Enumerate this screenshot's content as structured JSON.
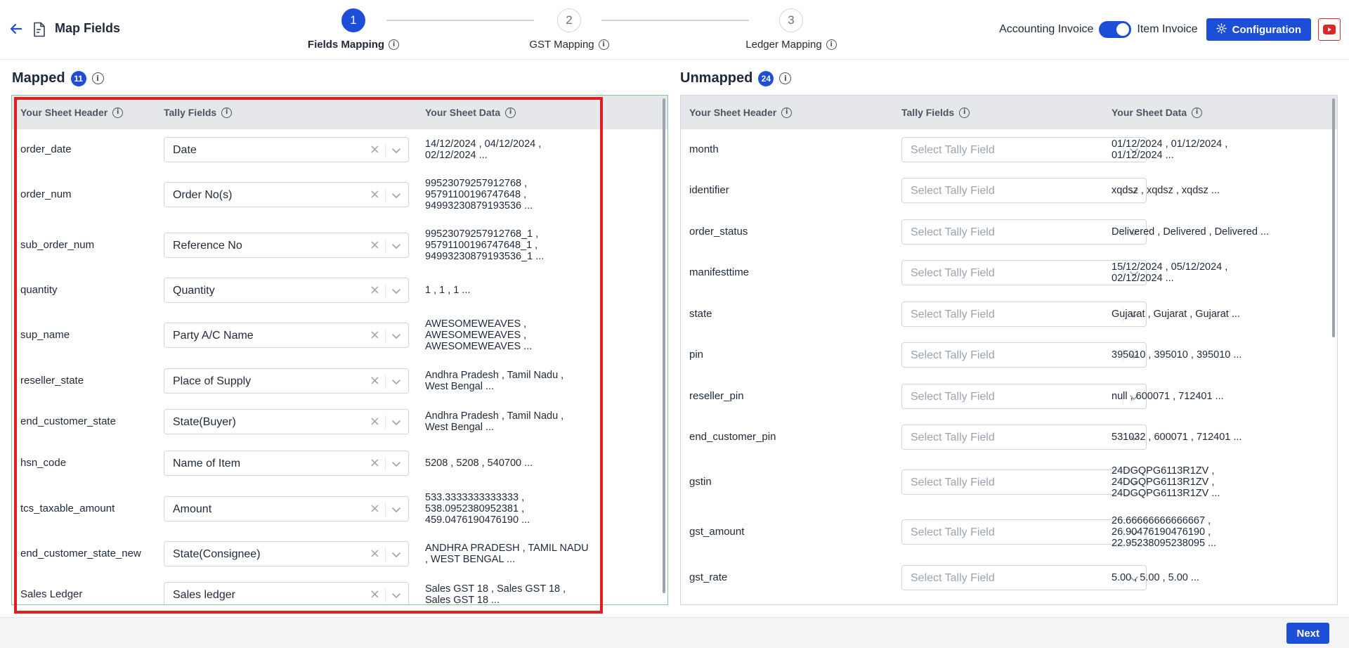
{
  "header": {
    "title": "Map Fields",
    "steps": [
      {
        "number": "1",
        "label": "Fields Mapping",
        "active": true
      },
      {
        "number": "2",
        "label": "GST Mapping",
        "active": false
      },
      {
        "number": "3",
        "label": "Ledger Mapping",
        "active": false
      }
    ],
    "toggle_left_label": "Accounting Invoice",
    "toggle_right_label": "Item Invoice",
    "config_label": "Configuration"
  },
  "mapped": {
    "title": "Mapped",
    "count": "11",
    "columns": [
      "Your Sheet Header",
      "Tally Fields",
      "Your Sheet Data"
    ],
    "rows": [
      {
        "header": "order_date",
        "field": "Date",
        "data": [
          "14/12/2024 , 04/12/2024 ,",
          "02/12/2024 ..."
        ]
      },
      {
        "header": "order_num",
        "field": "Order No(s)",
        "data": [
          "99523079257912768 ,",
          "95791100196747648 ,",
          "94993230879193536 ..."
        ]
      },
      {
        "header": "sub_order_num",
        "field": "Reference No",
        "data": [
          "99523079257912768_1 ,",
          "95791100196747648_1 ,",
          "94993230879193536_1 ..."
        ]
      },
      {
        "header": "quantity",
        "field": "Quantity",
        "data": [
          "1 , 1 , 1 ..."
        ]
      },
      {
        "header": "sup_name",
        "field": "Party A/C Name",
        "data": [
          "AWESOMEWEAVES ,",
          "AWESOMEWEAVES ,",
          "AWESOMEWEAVES ..."
        ]
      },
      {
        "header": "reseller_state",
        "field": "Place of Supply",
        "data": [
          "Andhra Pradesh , Tamil Nadu ,",
          "West Bengal ..."
        ]
      },
      {
        "header": "end_customer_state",
        "field": "State(Buyer)",
        "data": [
          "Andhra Pradesh , Tamil Nadu ,",
          "West Bengal ..."
        ]
      },
      {
        "header": "hsn_code",
        "field": "Name of Item",
        "data": [
          "5208 , 5208 , 540700 ..."
        ]
      },
      {
        "header": "tcs_taxable_amount",
        "field": "Amount",
        "data": [
          "533.3333333333333 ,",
          "538.0952380952381 ,",
          "459.0476190476190 ..."
        ]
      },
      {
        "header": "end_customer_state_new",
        "field": "State(Consignee)",
        "data": [
          "ANDHRA PRADESH , TAMIL NADU",
          ", WEST BENGAL ..."
        ]
      },
      {
        "header": "Sales Ledger",
        "field": "Sales ledger",
        "data": [
          "Sales GST 18 , Sales GST 18 ,",
          "Sales GST 18 ..."
        ]
      }
    ]
  },
  "unmapped": {
    "title": "Unmapped",
    "count": "24",
    "columns": [
      "Your Sheet Header",
      "Tally Fields",
      "Your Sheet Data"
    ],
    "placeholder": "Select Tally Field",
    "rows": [
      {
        "header": "month",
        "data": [
          "01/12/2024 , 01/12/2024 ,",
          "01/12/2024 ..."
        ]
      },
      {
        "header": "identifier",
        "data": [
          "xqdsz , xqdsz , xqdsz ..."
        ]
      },
      {
        "header": "order_status",
        "data": [
          "Delivered , Delivered , Delivered ..."
        ]
      },
      {
        "header": "manifesttime",
        "data": [
          "15/12/2024 , 05/12/2024 ,",
          "02/12/2024 ..."
        ]
      },
      {
        "header": "state",
        "data": [
          "Gujarat , Gujarat , Gujarat ..."
        ]
      },
      {
        "header": "pin",
        "data": [
          "395010 , 395010 , 395010 ..."
        ]
      },
      {
        "header": "reseller_pin",
        "data": [
          "null , 600071 , 712401 ..."
        ]
      },
      {
        "header": "end_customer_pin",
        "data": [
          "531032 , 600071 , 712401 ..."
        ]
      },
      {
        "header": "gstin",
        "data": [
          "24DGQPG6113R1ZV ,",
          "24DGQPG6113R1ZV ,",
          "24DGQPG6113R1ZV ..."
        ]
      },
      {
        "header": "gst_amount",
        "data": [
          "26.66666666666667 ,",
          "26.90476190476190 ,",
          "22.95238095238095 ..."
        ]
      },
      {
        "header": "gst_rate",
        "data": [
          "5.00 , 5.00 , 5.00 ..."
        ]
      }
    ]
  },
  "footer": {
    "next_label": "Next"
  },
  "colors": {
    "accent": "#1d4ed8",
    "highlight": "#e11d1d",
    "mapped_border": "#86c7a3"
  },
  "icons": [
    "arrow-left-icon",
    "document-icon",
    "info-icon",
    "gear-icon",
    "youtube-icon",
    "chevron-down-icon",
    "clear-icon"
  ]
}
